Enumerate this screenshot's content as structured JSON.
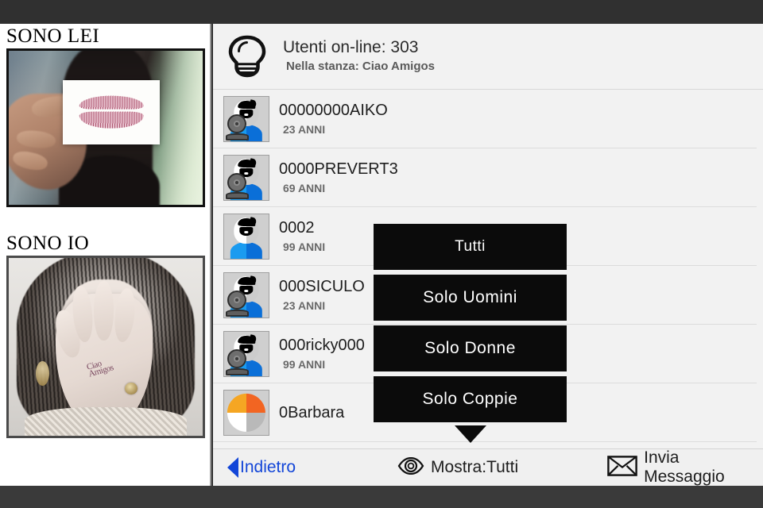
{
  "left_panel": {
    "photo_top": {
      "caption": "SONO LEI",
      "alt": "woman holding white card with lipstick kiss mark"
    },
    "photo_bottom": {
      "caption": "SONO IO",
      "alt": "black and white portrait of woman with hand covering face",
      "tattoo_text": "Ciao Amigos"
    }
  },
  "header": {
    "icon": "lightbulb-icon",
    "online_label": "Utenti on-line: 303",
    "room_label": "Nella stanza: Ciao Amigos"
  },
  "users": [
    {
      "name": "00000000AIKO",
      "age": "23 ANNI",
      "avatar": "user-webcam-avatar"
    },
    {
      "name": "0000PREVERT3",
      "age": "69 ANNI",
      "avatar": "user-webcam-avatar"
    },
    {
      "name": "0002",
      "age": "99 ANNI",
      "avatar": "user-avatar"
    },
    {
      "name": "000SICULO",
      "age": "23 ANNI",
      "avatar": "user-webcam-avatar"
    },
    {
      "name": "000ricky000",
      "age": "99 ANNI",
      "avatar": "user-webcam-avatar"
    },
    {
      "name": "0Barbara",
      "age": "",
      "avatar": "user-pie-avatar"
    }
  ],
  "dropdown": {
    "items": [
      {
        "label": "Tutti"
      },
      {
        "label": "Solo Uomini"
      },
      {
        "label": "Solo Donne"
      },
      {
        "label": "Solo Coppie"
      }
    ]
  },
  "toolbar": {
    "back_label": "Indietro",
    "filter_icon": "eye-icon",
    "filter_label": "Mostra:Tutti",
    "message_icon": "envelope-icon",
    "message_label": "Invia Messaggio"
  },
  "colors": {
    "accent_blue": "#1346d8",
    "avatar_blue": "#0a6fd8",
    "panel_bg": "#f2f2f2",
    "menu_bg": "#0b0b0b",
    "chrome": "#303030"
  }
}
